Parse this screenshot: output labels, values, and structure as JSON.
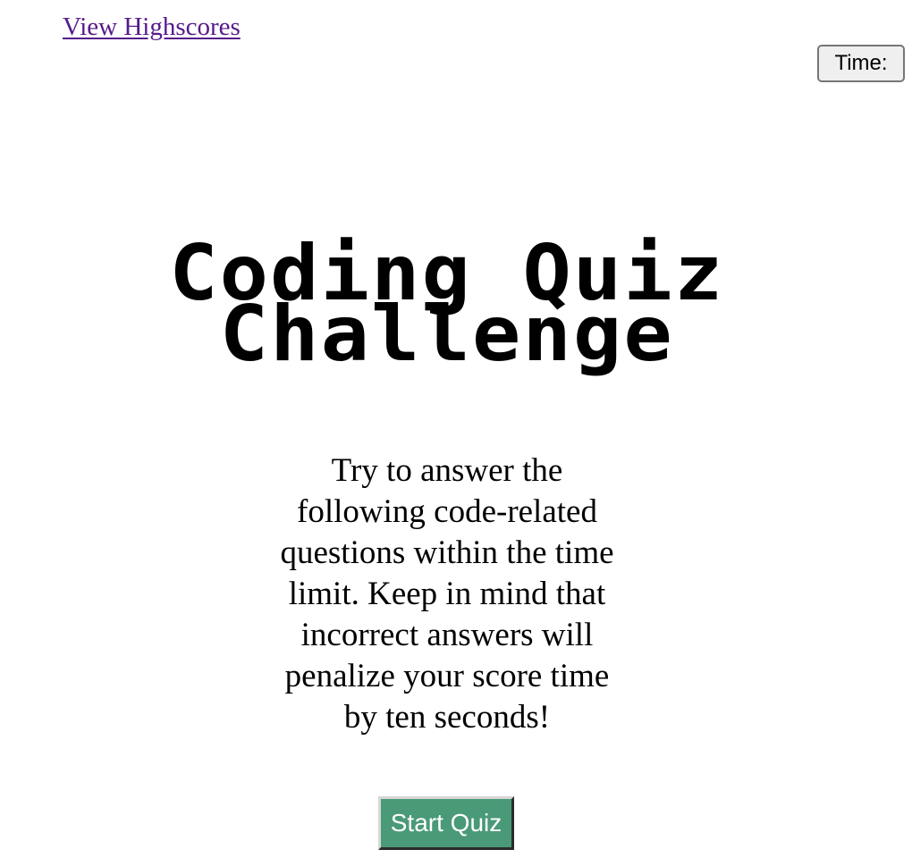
{
  "nav": {
    "highscores_label": "View Highscores"
  },
  "timer": {
    "label": "Time:"
  },
  "title": {
    "line1": "Coding Quiz",
    "line2": "Challenge"
  },
  "intro": {
    "text": "Try to answer the following code-related questions within the time limit. Keep in mind that incorrect answers will penalize your score time by ten seconds!"
  },
  "actions": {
    "start_label": "Start Quiz"
  },
  "colors": {
    "link": "#551a8b",
    "start_button": "#4a9a78",
    "timer_button": "#efefef"
  }
}
